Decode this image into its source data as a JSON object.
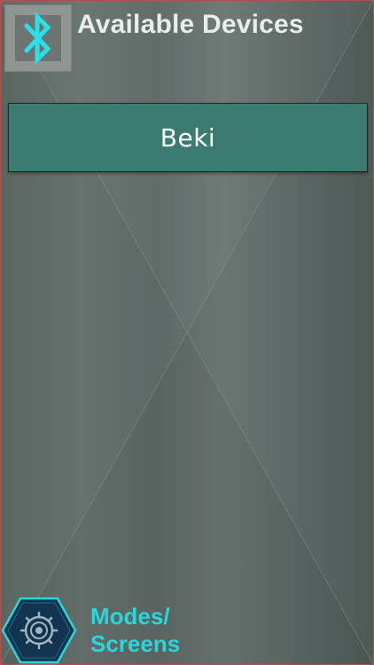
{
  "header": {
    "title": "Available Devices",
    "bluetooth_icon": "bluetooth-icon"
  },
  "devices": [
    {
      "label": "Beki"
    }
  ],
  "footer": {
    "modes_label_line1": "Modes/",
    "modes_label_line2": "Screens",
    "modes_icon": "settings-gear-icon"
  },
  "colors": {
    "accent": "#2ad6db",
    "device_row": "#3c7b70",
    "title_text": "#e9edeb",
    "background": "#5f6b68"
  }
}
